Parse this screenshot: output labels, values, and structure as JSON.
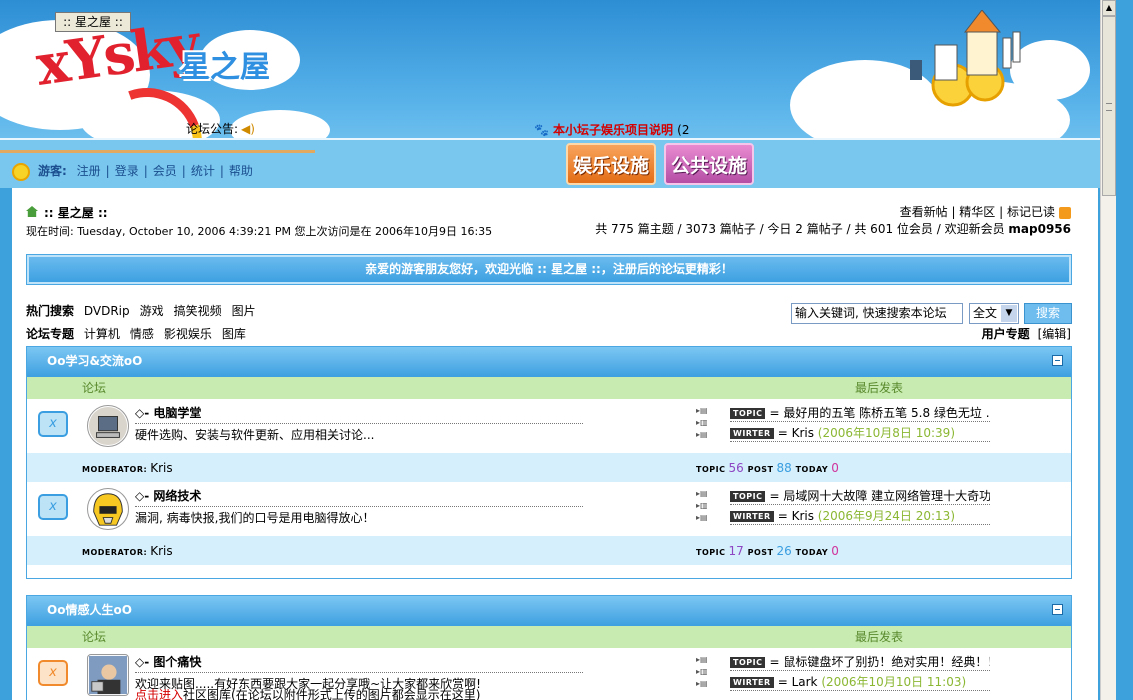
{
  "header": {
    "window_title": ":: 星之屋 ::",
    "logo_text": "xYsky",
    "logo_cn": "星之屋",
    "announce_label": "论坛公告:",
    "notice_link": "本小坛子娱乐项目说明",
    "notice_tail": "(2",
    "btn_entertainment": "娱乐设施",
    "btn_public": "公共设施"
  },
  "guestbar": {
    "label": "游客:",
    "links": [
      "注册",
      "登录",
      "会员",
      "统计",
      "帮助"
    ]
  },
  "breadcrumb": ":: 星之屋 ::",
  "time_line": "现在时间: Tuesday, October 10, 2006 4:39:21 PM   您上次访问是在 2006年10月9日 16:35",
  "toplinks": [
    "查看新帖",
    "精华区",
    "标记已读"
  ],
  "stats": {
    "prefix": "共 775 篇主题 / 3073 篇帖子 / 今日 2 篇帖子 / 共 601 位会员 / 欢迎新会员",
    "new_member": "map0956"
  },
  "welcome": "亲爱的游客朋友您好，欢迎光临 :: 星之屋 ::，注册后的论坛更精彩！",
  "hot_search": {
    "label": "热门搜索",
    "items": [
      "DVDRip",
      "游戏",
      "搞笑视频",
      "图片"
    ]
  },
  "topics": {
    "label": "论坛专题",
    "items": [
      "计算机",
      "情感",
      "影视娱乐",
      "图库"
    ]
  },
  "search": {
    "placeholder": "输入关键词, 快速搜索本论坛",
    "scope": "全文",
    "button": "搜索"
  },
  "userzone": {
    "label": "用户专题",
    "edit": "[编辑]"
  },
  "column_headers": {
    "forum": "论坛",
    "last_post": "最后发表"
  },
  "mini_icons": [
    "▸▤",
    "▸▥",
    "▸▤"
  ],
  "labels": {
    "topic_tag": "TOPIC",
    "writer_tag": "WIRTER",
    "moderator": "MODERATOR:",
    "topic": "TOPIC",
    "post": "POST",
    "today": "TODAY",
    "eq": "="
  },
  "sections": [
    {
      "title": "Oo学习&交流oO",
      "forums": [
        {
          "name": "◇- 电脑学堂",
          "desc": "硬件选购、安装与软件更新、应用相关讨论...",
          "last_topic": "最好用的五笔 陈桥五笔 5.8 绿色无垃 ...",
          "writer": "Kris",
          "date": "(2006年10月8日 10:39)",
          "moderator": "Kris",
          "topic_count": "56",
          "post_count": "88",
          "today_count": "0"
        },
        {
          "name": "◇- 网络技术",
          "desc": "漏洞, 病毒快报,我们的口号是用电脑得放心！",
          "last_topic": "局域网十大故障 建立网络管理十大奇功",
          "writer": "Kris",
          "date": "(2006年9月24日 20:13)",
          "moderator": "Kris",
          "topic_count": "17",
          "post_count": "26",
          "today_count": "0"
        }
      ]
    },
    {
      "title": "Oo情感人生oO",
      "forums": [
        {
          "name": "◇- 图个痛快",
          "desc": "欢迎来贴图.....有好东西要跟大家一起分享哦~让大家都来欣赏啊!",
          "desc_red": "点击进入",
          "desc2": "社区图库(在论坛以附件形式上传的图片都会显示在这里)",
          "last_topic": "鼠标键盘坏了别扔！绝对实用！经典！！",
          "writer": "Lark",
          "date": "(2006年10月10日 11:03)"
        }
      ]
    }
  ]
}
